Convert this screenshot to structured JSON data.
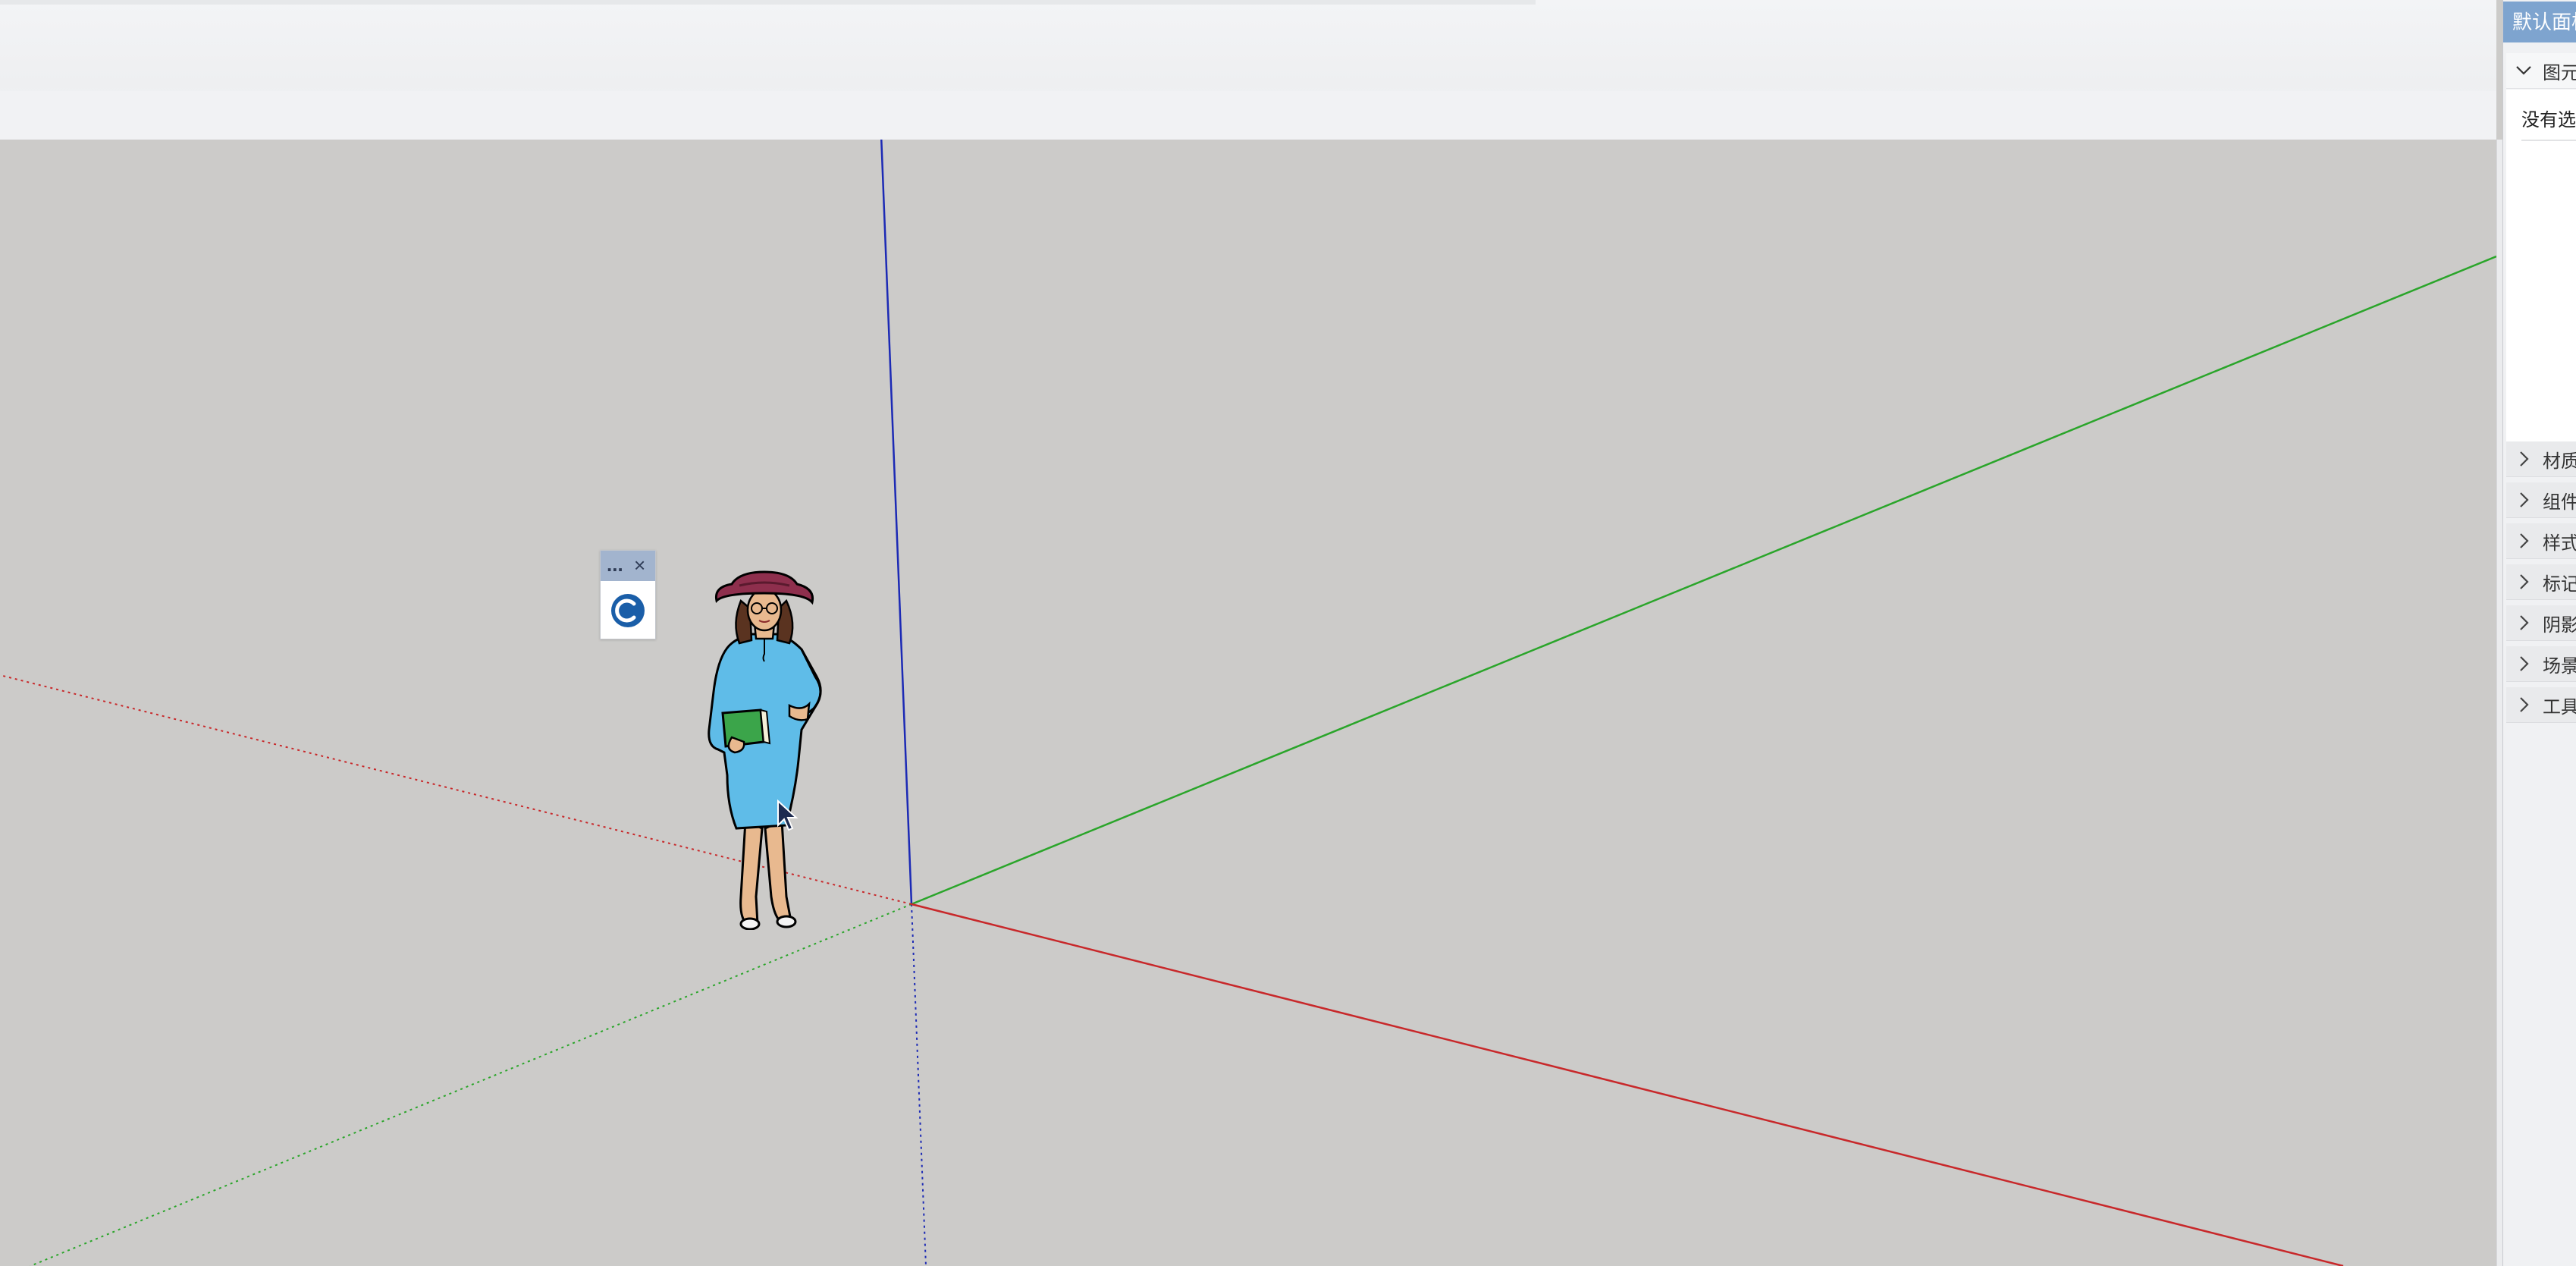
{
  "tray": {
    "title": "默认面板",
    "sections": [
      {
        "id": "entity-info",
        "label": "图元信息",
        "expanded": true
      },
      {
        "id": "materials",
        "label": "材质",
        "expanded": false
      },
      {
        "id": "components",
        "label": "组件",
        "expanded": false
      },
      {
        "id": "styles",
        "label": "样式",
        "expanded": false
      },
      {
        "id": "tags",
        "label": "标记",
        "expanded": false
      },
      {
        "id": "shadows",
        "label": "阴影",
        "expanded": false
      },
      {
        "id": "scenes",
        "label": "场景",
        "expanded": false
      },
      {
        "id": "tools",
        "label": "工具向导",
        "expanded": false
      }
    ],
    "entity_info_text": "没有选择内容"
  },
  "popup": {
    "more_label": "...",
    "close_label": "×",
    "tool_icon": "scale-tool-icon"
  },
  "viewport": {
    "background_color": "#cccbc9",
    "axis_colors": {
      "red": "#c8282a",
      "green": "#2aa52a",
      "blue": "#1c2ab5"
    },
    "model": "person-figure-woman-blue-dress"
  },
  "colors": {
    "tray_title_bg": "#7ea4cf",
    "popup_header_bg": "#a2b4ce",
    "scale_icon": "#1a5ea8"
  }
}
